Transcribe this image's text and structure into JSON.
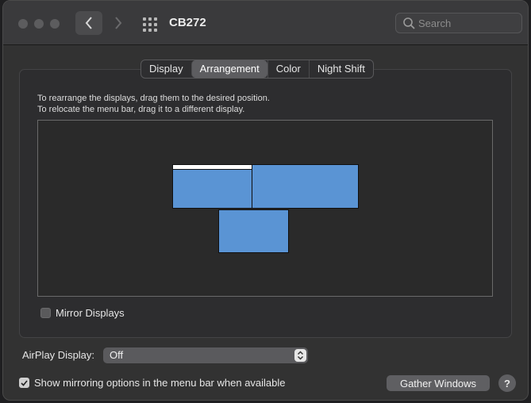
{
  "window": {
    "title": "CB272"
  },
  "search": {
    "placeholder": "Search"
  },
  "tabs": [
    {
      "label": "Display",
      "active": false
    },
    {
      "label": "Arrangement",
      "active": true
    },
    {
      "label": "Color",
      "active": false
    },
    {
      "label": "Night Shift",
      "active": false
    }
  ],
  "instructions": {
    "line1": "To rearrange the displays, drag them to the desired position.",
    "line2": "To relocate the menu bar, drag it to a different display."
  },
  "arrangement": {
    "display_color": "#5a94d4",
    "menu_bar_on": "display-left"
  },
  "mirror": {
    "label": "Mirror Displays",
    "checked": false
  },
  "airplay": {
    "label": "AirPlay Display:",
    "value": "Off"
  },
  "show_mirroring": {
    "label": "Show mirroring options in the menu bar when available",
    "checked": true
  },
  "gather": {
    "label": "Gather Windows"
  },
  "help": {
    "label": "?"
  },
  "icons": {
    "back": "chevron-left-icon",
    "forward": "chevron-right-icon",
    "grid": "grid-icon",
    "search": "search-icon",
    "stepper": "chevron-updown-icon"
  }
}
